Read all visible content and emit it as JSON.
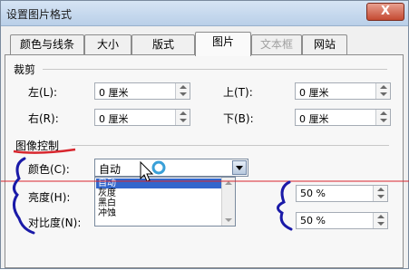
{
  "dialog": {
    "title": "设置图片格式",
    "close_glyph": "X"
  },
  "tabs": [
    {
      "label": "颜色与线条",
      "state": "normal"
    },
    {
      "label": "大小",
      "state": "normal"
    },
    {
      "label": "版式",
      "state": "normal"
    },
    {
      "label": "图片",
      "state": "active"
    },
    {
      "label": "文本框",
      "state": "disabled"
    },
    {
      "label": "网站",
      "state": "normal"
    }
  ],
  "crop": {
    "heading": "裁剪",
    "left_label": "左(L):",
    "left_value": "0 厘米",
    "top_label": "上(T):",
    "top_value": "0 厘米",
    "right_label": "右(R):",
    "right_value": "0 厘米",
    "bottom_label": "下(B):",
    "bottom_value": "0 厘米"
  },
  "image_control": {
    "heading": "图像控制",
    "color_label": "颜色(C):",
    "color_value": "自动",
    "color_options": [
      "自动",
      "灰度",
      "黑白",
      "冲蚀"
    ],
    "brightness_label": "亮度(H):",
    "brightness_value": "50 %",
    "contrast_label": "对比度(N):",
    "contrast_value": "50 %"
  },
  "colors": {
    "ink": "#1a1aa8",
    "underline": "#d8262e",
    "selection": "#3366cc"
  }
}
